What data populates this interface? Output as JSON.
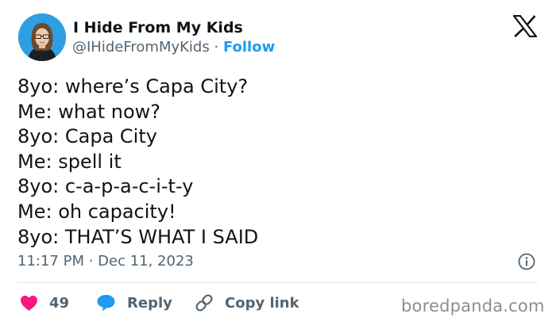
{
  "author": {
    "display_name": "I Hide From My Kids",
    "handle": "@IHideFromMyKids",
    "separator": "·",
    "follow_label": "Follow"
  },
  "tweet": {
    "lines": [
      "8yo: where’s Capa City?",
      "Me: what now?",
      "8yo: Capa City",
      "Me: spell it",
      "8yo: c-a-p-a-c-i-t-y",
      "Me: oh capacity!",
      "8yo: THAT’S WHAT I SAID"
    ],
    "timestamp": "11:17 PM · Dec 11, 2023"
  },
  "actions": {
    "like_count": "49",
    "reply_label": "Reply",
    "copy_link_label": "Copy link"
  },
  "watermark": "boredpanda.com",
  "icons": {
    "platform_logo": "x-logo-icon",
    "info": "info-icon",
    "like": "heart-icon",
    "reply": "speech-bubble-icon",
    "copy_link": "link-icon"
  },
  "colors": {
    "text": "#0f1419",
    "secondary_text": "#536471",
    "accent": "#1d9bf0",
    "like": "#f91880",
    "divider": "#e3e8eb"
  }
}
